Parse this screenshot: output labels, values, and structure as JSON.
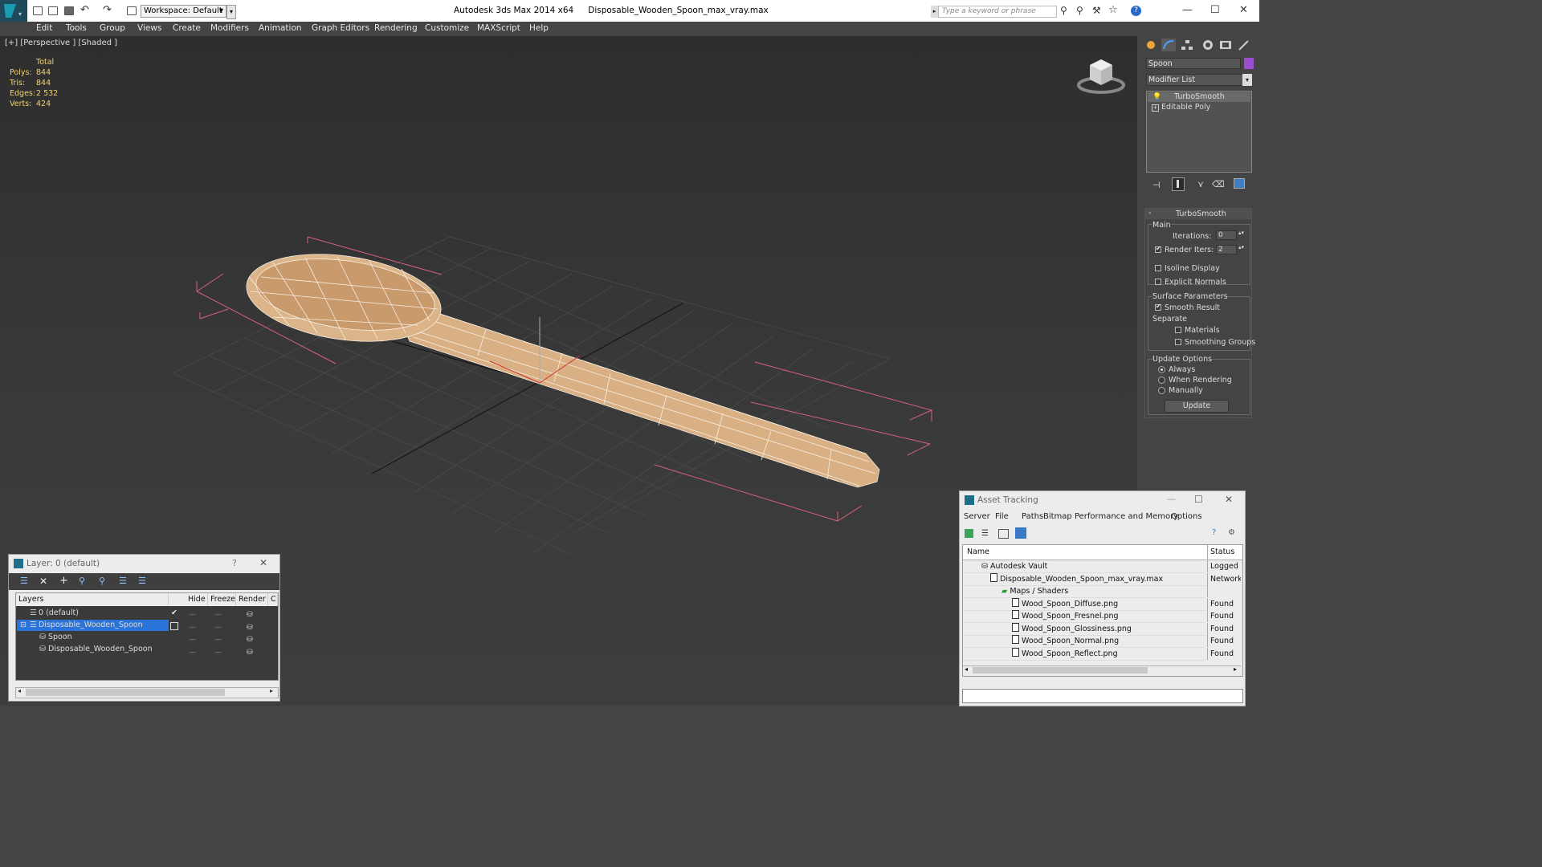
{
  "titlebar": {
    "app": "Autodesk 3ds Max  2014 x64",
    "file": "Disposable_Wooden_Spoon_max_vray.max",
    "workspace": "Workspace: Default",
    "search_placeholder": "Type a keyword or phrase"
  },
  "menu": [
    "Edit",
    "Tools",
    "Group",
    "Views",
    "Create",
    "Modifiers",
    "Animation",
    "Graph Editors",
    "Rendering",
    "Customize",
    "MAXScript",
    "Help"
  ],
  "viewport": {
    "label": "[+] [Perspective ] [Shaded ]",
    "stats_header": "Total",
    "stats": [
      {
        "label": "Polys:",
        "value": "844"
      },
      {
        "label": "Tris:",
        "value": "844"
      },
      {
        "label": "Edges:",
        "value": "2 532"
      },
      {
        "label": "Verts:",
        "value": "424"
      }
    ]
  },
  "command_panel": {
    "object_name": "Spoon",
    "object_color": "#9b4fd0",
    "modifier_list": "Modifier List",
    "stack": [
      "TurboSmooth",
      "Editable Poly"
    ],
    "rollout_title": "TurboSmooth",
    "main_label": "Main",
    "iterations_label": "Iterations:",
    "iterations_value": "0",
    "render_iters_label": "Render Iters:",
    "render_iters_value": "2",
    "isoline": "Isoline Display",
    "explicit_normals": "Explicit Normals",
    "surface_params": "Surface Parameters",
    "smooth_result": "Smooth Result",
    "separate": "Separate",
    "materials": "Materials",
    "smoothing_groups": "Smoothing Groups",
    "update_options": "Update Options",
    "always": "Always",
    "when_rendering": "When Rendering",
    "manually": "Manually",
    "update_button": "Update"
  },
  "layer_window": {
    "title": "Layer: 0 (default)",
    "help": "?",
    "close": "✕",
    "columns": [
      "Layers",
      "Hide",
      "Freeze",
      "Render",
      "C"
    ],
    "rows": [
      "0 (default)",
      "Disposable_Wooden_Spoon",
      "Spoon",
      "Disposable_Wooden_Spoon"
    ]
  },
  "asset_window": {
    "title": "Asset Tracking",
    "menu": [
      "Server",
      "File",
      "Paths",
      "Bitmap Performance and Memory",
      "Options"
    ],
    "columns": [
      "Name",
      "Status"
    ],
    "rows": [
      {
        "name": "Autodesk Vault",
        "status": "Logged C"
      },
      {
        "name": "Disposable_Wooden_Spoon_max_vray.max",
        "status": "Network"
      },
      {
        "name": "Maps / Shaders",
        "status": ""
      },
      {
        "name": "Wood_Spoon_Diffuse.png",
        "status": "Found"
      },
      {
        "name": "Wood_Spoon_Fresnel.png",
        "status": "Found"
      },
      {
        "name": "Wood_Spoon_Glossiness.png",
        "status": "Found"
      },
      {
        "name": "Wood_Spoon_Normal.png",
        "status": "Found"
      },
      {
        "name": "Wood_Spoon_Reflect.png",
        "status": "Found"
      }
    ]
  }
}
